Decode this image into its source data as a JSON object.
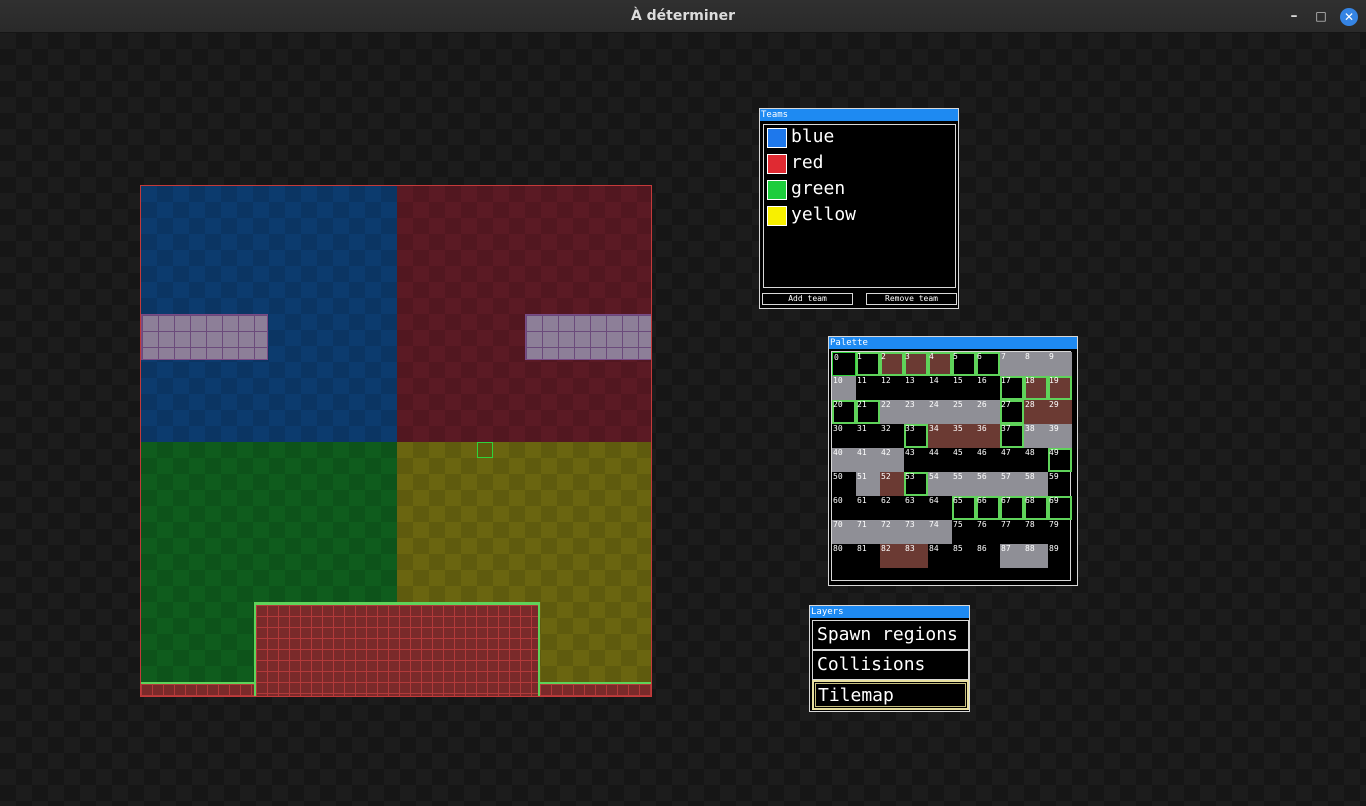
{
  "window": {
    "title": "À déterminer",
    "minimize_glyph": "–",
    "maximize_glyph": "□",
    "close_glyph": "✕"
  },
  "teams": {
    "title": "Teams",
    "items": [
      {
        "name": "blue",
        "color": "#1e78ec"
      },
      {
        "name": "red",
        "color": "#e02a32"
      },
      {
        "name": "green",
        "color": "#1ccd3c"
      },
      {
        "name": "yellow",
        "color": "#f8f000"
      }
    ],
    "add_label": "Add team",
    "remove_label": "Remove team"
  },
  "palette": {
    "title": "Palette",
    "tiles": [
      "0",
      "1",
      "2",
      "3",
      "4",
      "5",
      "6",
      "7",
      "8",
      "9",
      "10",
      "11",
      "12",
      "13",
      "14",
      "15",
      "16",
      "17",
      "18",
      "19",
      "20",
      "21",
      "22",
      "23",
      "24",
      "25",
      "26",
      "27",
      "28",
      "29",
      "30",
      "31",
      "32",
      "33",
      "34",
      "35",
      "36",
      "37",
      "38",
      "39",
      "40",
      "41",
      "42",
      "43",
      "44",
      "45",
      "46",
      "47",
      "48",
      "49",
      "50",
      "51",
      "52",
      "53",
      "54",
      "55",
      "56",
      "57",
      "58",
      "59",
      "60",
      "61",
      "62",
      "63",
      "64",
      "65",
      "66",
      "67",
      "68",
      "69",
      "70",
      "71",
      "72",
      "73",
      "74",
      "75",
      "76",
      "77",
      "78",
      "79",
      "80",
      "81",
      "82",
      "83",
      "84",
      "85",
      "86",
      "87",
      "88",
      "89"
    ]
  },
  "layers": {
    "title": "Layers",
    "items": [
      "Spawn regions",
      "Collisions",
      "Tilemap"
    ],
    "selected": "Tilemap"
  }
}
